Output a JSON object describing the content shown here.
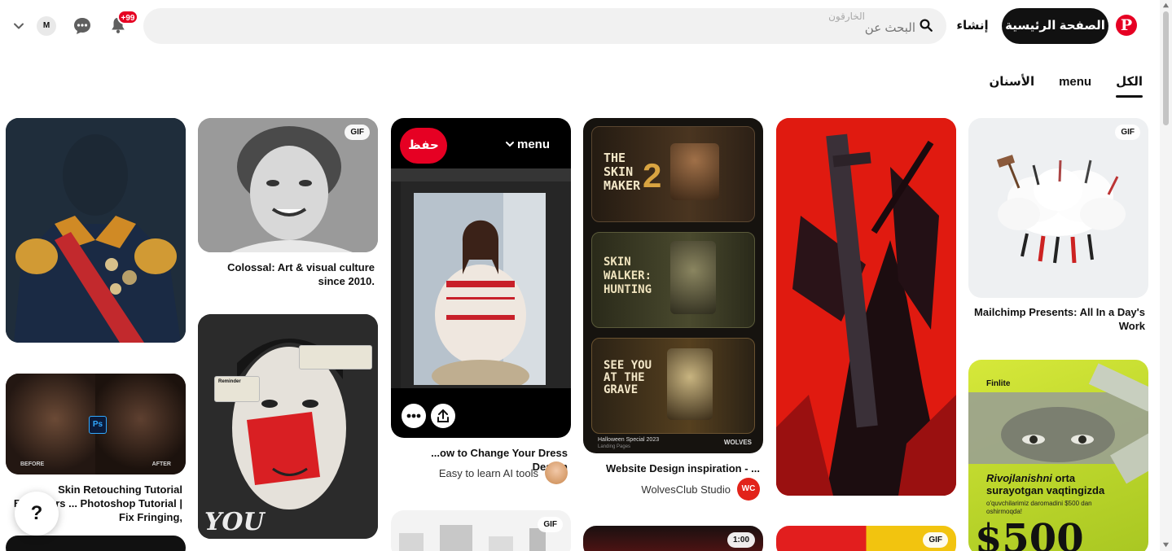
{
  "header": {
    "logo_icon": "pinterest-logo-icon",
    "logo_letter": "P",
    "home_label": "الصفحة الرئيسية",
    "create_label": "إنشاء",
    "search_placeholder": "البحث عن",
    "search_hint": "الخارقون",
    "notifications_badge": "+99",
    "avatar_initial": "M",
    "accent_color": "#e60023"
  },
  "tabs": [
    {
      "label": "الكل",
      "active": true
    },
    {
      "label": "menu",
      "active": false
    },
    {
      "label": "الأسنان",
      "active": false
    }
  ],
  "pins": {
    "mailchimp": {
      "title": "Mailchimp Presents: All In a Day's Work",
      "tag": "GIF"
    },
    "finlite": {
      "brand": "Finlite",
      "headline_italic": "Rivojlanishni",
      "headline_rest": "orta surayotgan vaqtingizda",
      "sub": "o'quvchilarimiz daromadini $500 dan oshirmoqda!"
    },
    "website": {
      "title": "Website Design inspiration - ...",
      "creator": "WolvesClub Studio",
      "creator_initials": "WC",
      "tag2": "1:00",
      "screens": [
        {
          "headline": "THE SKIN MAKER",
          "number": "2"
        },
        {
          "headline": "SKIN WALKER: HUNTING"
        },
        {
          "headline": "SEE YOU AT THE GRAVE",
          "footer": "Halloween Special 2023",
          "footer_sub": "Landing Pages",
          "footer_brand": "WOLVES"
        }
      ]
    },
    "dress": {
      "title": "...ow to Change Your Dress Design",
      "creator": "Easy to learn AI tools",
      "save_label": "حفظ",
      "board_label": "menu",
      "tag2": "GIF"
    },
    "colossal": {
      "title": "Colossal: Art & visual culture since 2010.",
      "tag": "GIF"
    },
    "you": {
      "text": "YOU",
      "reminder_title": "Reminder"
    },
    "retouch": {
      "title": "Skin Retouching Tutorial Beginners ... Photoshop Tutorial | Fix Fringing,",
      "before": "BEFORE",
      "after": "AFTER",
      "ps": "Ps"
    },
    "yellow": {
      "tag": "GIF"
    }
  },
  "help_label": "?"
}
